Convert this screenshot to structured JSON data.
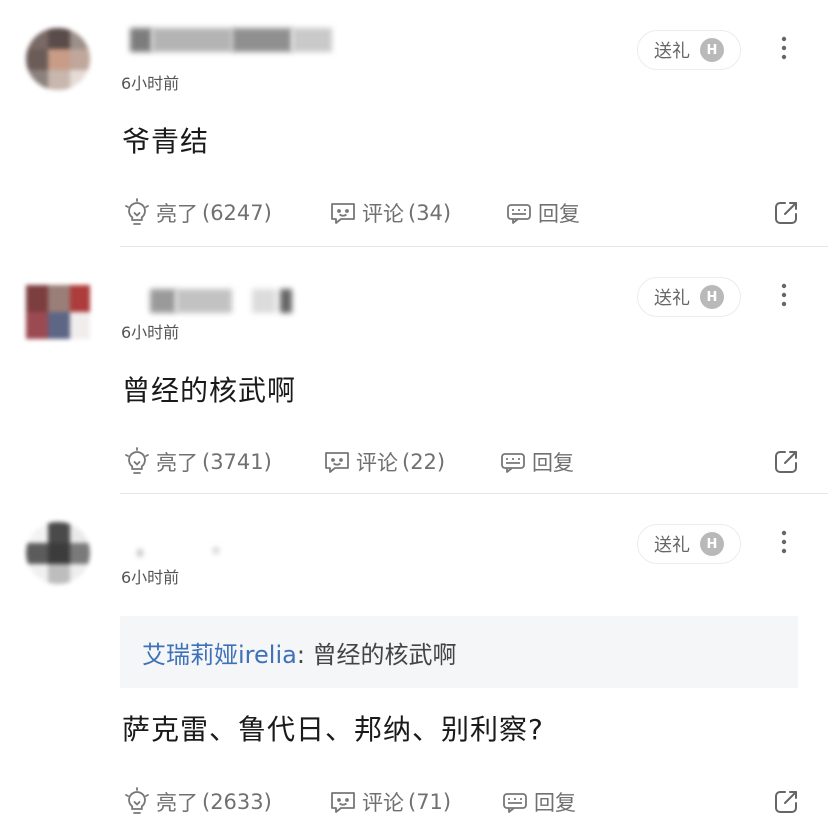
{
  "comments": [
    {
      "time": "6小时前",
      "gift_label": "送礼",
      "badge": "H",
      "text": "爷青结",
      "like_label": "亮了",
      "like_count": "(6247)",
      "comment_label": "评论",
      "comment_count": "(34)",
      "reply_label": "回复"
    },
    {
      "time": "6小时前",
      "gift_label": "送礼",
      "badge": "H",
      "text": "曾经的核武啊",
      "like_label": "亮了",
      "like_count": "(3741)",
      "comment_label": "评论",
      "comment_count": "(22)",
      "reply_label": "回复"
    },
    {
      "time": "6小时前",
      "gift_label": "送礼",
      "badge": "H",
      "quote_name": "艾瑞莉娅irelia",
      "quote_text": ": 曾经的核武啊",
      "text": "萨克雷、鲁代日、邦纳、别利察?",
      "like_label": "亮了",
      "like_count": "(2633)",
      "comment_label": "评论",
      "comment_count": "(71)",
      "reply_label": "回复"
    }
  ],
  "colors": {
    "text_primary": "#1a1a1a",
    "text_secondary": "#707070",
    "quote_name": "#3e71b8",
    "quote_bg": "#f4f6f8",
    "badge_bg": "#b9b9b9"
  },
  "icons": [
    "more-vertical-icon",
    "lightbulb-icon",
    "comment-bubble-icon",
    "reply-bubble-icon",
    "share-icon"
  ]
}
